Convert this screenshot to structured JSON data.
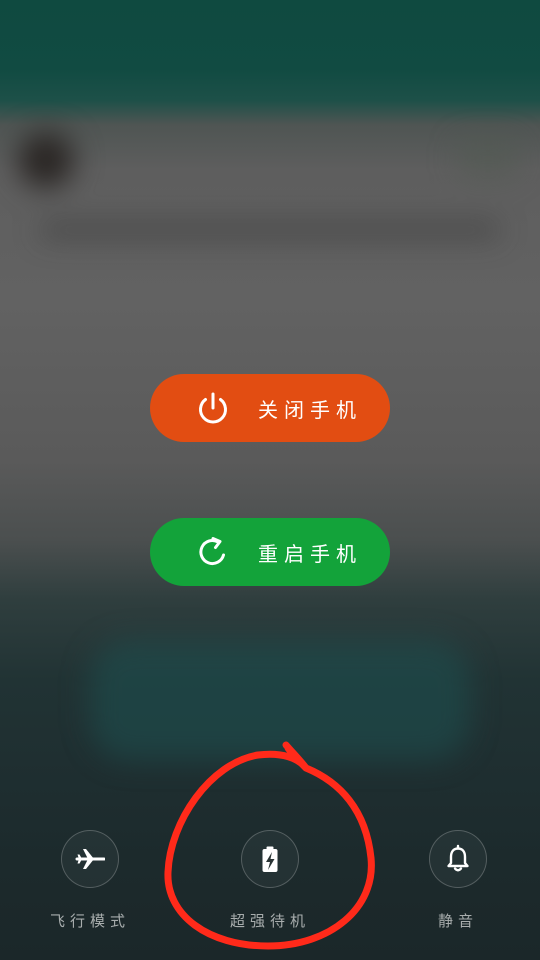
{
  "power_menu": {
    "shutdown_label": "关闭手机",
    "restart_label": "重启手机",
    "shutdown_color": "#e24d12",
    "restart_color": "#13a33a",
    "shutdown_icon": "power-icon",
    "restart_icon": "restart-icon"
  },
  "quick_actions": [
    {
      "label": "飞行模式",
      "icon": "airplane-icon"
    },
    {
      "label": "超强待机",
      "icon": "battery-bolt-icon"
    },
    {
      "label": "静音",
      "icon": "bell-icon"
    }
  ],
  "annotation": {
    "color": "#ff2a1a"
  }
}
